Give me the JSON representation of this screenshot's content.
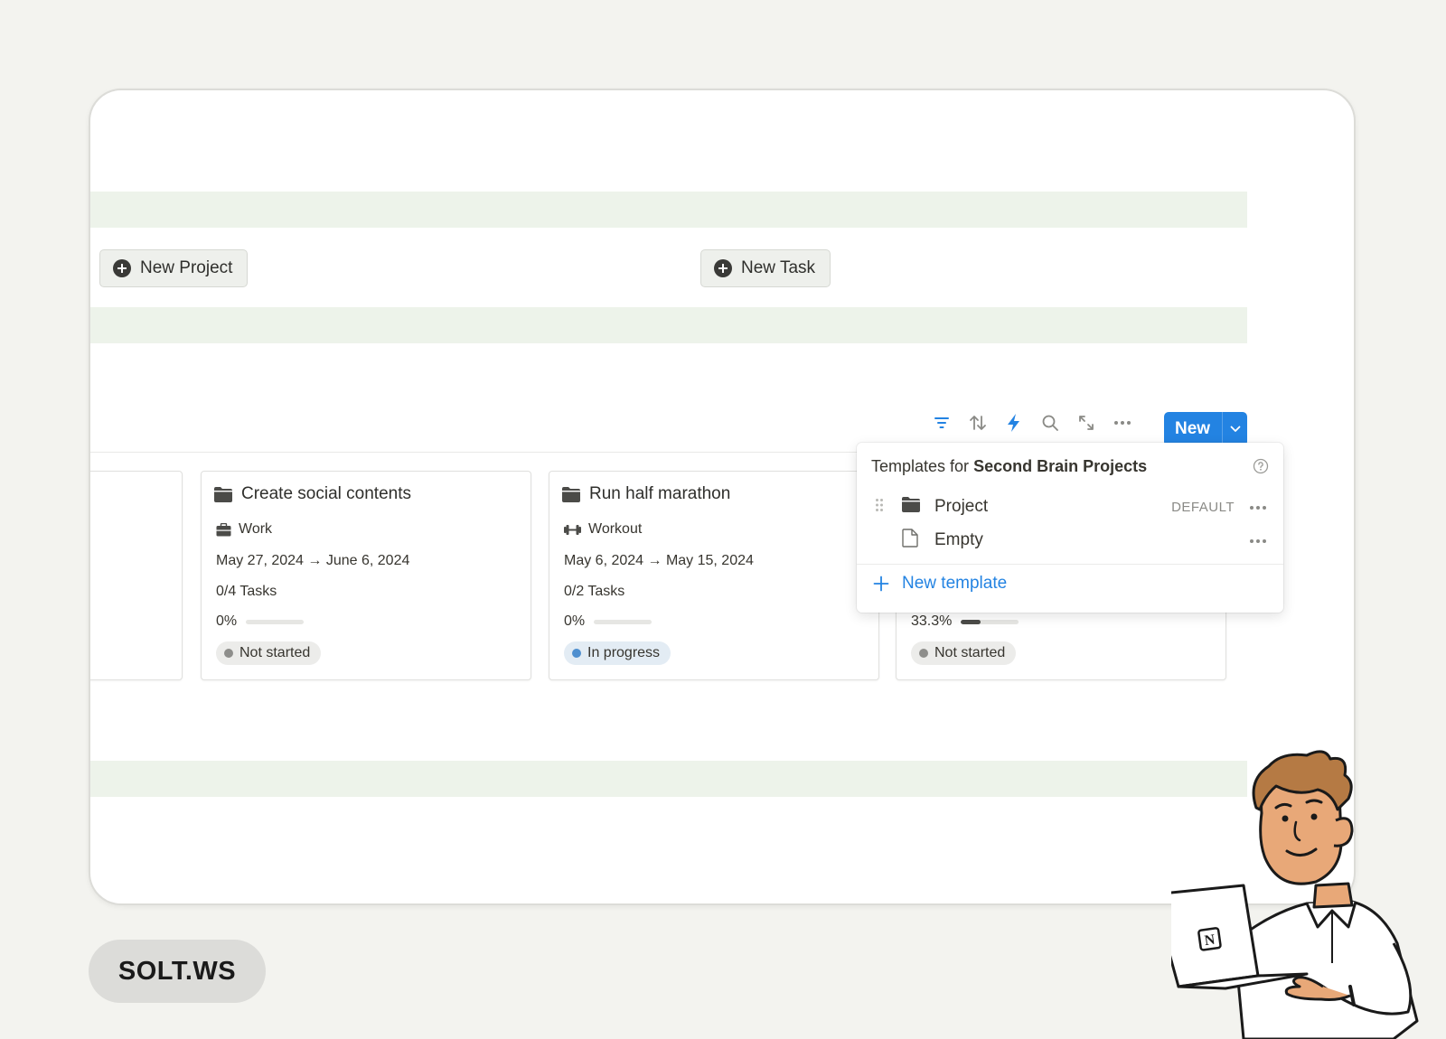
{
  "buttons": {
    "new_project": "New Project",
    "new_task": "New Task",
    "new": "New"
  },
  "toolbar": {
    "icons": [
      "filter-icon",
      "sort-icon",
      "automation-icon",
      "search-icon",
      "expand-icon",
      "more-icon"
    ]
  },
  "cards": [
    {
      "title": "Create social contents",
      "category": "Work",
      "dates": "May 27, 2024 → June 6, 2024",
      "tasks": "0/4 Tasks",
      "progress_label": "0%",
      "progress": 0,
      "status": "Not started"
    },
    {
      "title": "Run half marathon",
      "category": "Workout",
      "dates": "May 6, 2024 → May 15, 2024",
      "tasks": "0/2 Tasks",
      "progress_label": "0%",
      "progress": 0,
      "status": "In progress"
    },
    {
      "progress_label": "33.3%",
      "progress": 0.333,
      "status": "Not started"
    }
  ],
  "templates_popup": {
    "header_prefix": "Templates for",
    "header_db": "Second Brain Projects",
    "items": [
      {
        "label": "Project",
        "badge": "DEFAULT"
      },
      {
        "label": "Empty"
      }
    ],
    "new_template": "New template"
  },
  "brand": "SOLT.WS",
  "colors": {
    "accent": "#2383e2",
    "band": "#edf3ea",
    "background": "#f3f3ef",
    "in_progress_dot": "#4f8fcf"
  }
}
